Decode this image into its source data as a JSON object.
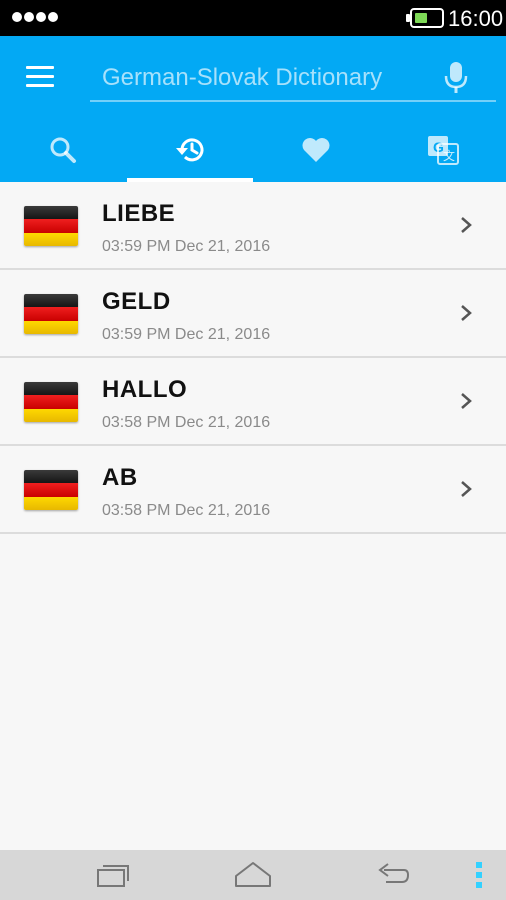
{
  "status_bar": {
    "time": "16:00",
    "battery_color": "#7ed957"
  },
  "app_bar": {
    "background_color": "#03a9f4",
    "search_placeholder": "German-Slovak Dictionary",
    "menu_icon": "hamburger-menu-icon",
    "mic_icon": "microphone-icon",
    "tabs": [
      {
        "id": "search",
        "icon": "search-icon",
        "active": false
      },
      {
        "id": "history",
        "icon": "history-icon",
        "active": true
      },
      {
        "id": "favorites",
        "icon": "heart-icon",
        "active": false
      },
      {
        "id": "translate",
        "icon": "translate-icon",
        "active": false
      }
    ]
  },
  "history": [
    {
      "word": "LIEBE",
      "timestamp": "03:59 PM Dec 21, 2016",
      "flag": "germany-flag-icon"
    },
    {
      "word": "GELD",
      "timestamp": "03:59 PM Dec 21, 2016",
      "flag": "germany-flag-icon"
    },
    {
      "word": "HALLO",
      "timestamp": "03:58 PM Dec 21, 2016",
      "flag": "germany-flag-icon"
    },
    {
      "word": "AB",
      "timestamp": "03:58 PM Dec 21, 2016",
      "flag": "germany-flag-icon"
    }
  ],
  "nav_bar": {
    "buttons": [
      "recent-apps-icon",
      "home-icon",
      "back-icon",
      "overflow-menu-icon"
    ],
    "accent_color": "#33d1ff"
  }
}
